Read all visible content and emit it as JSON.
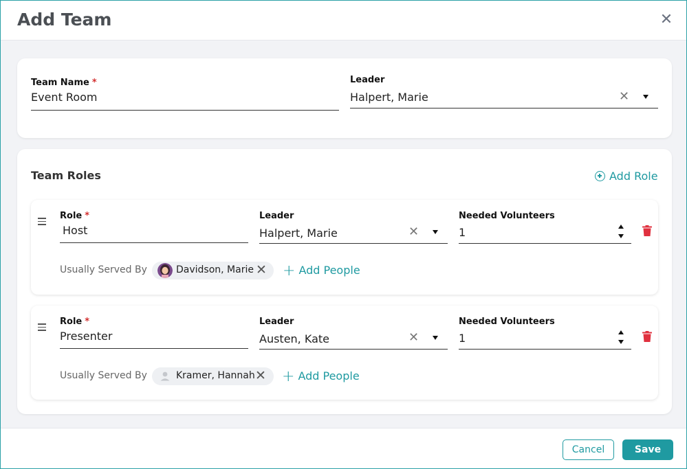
{
  "dialog": {
    "title": "Add Team",
    "close_icon": "close-icon"
  },
  "team": {
    "name_label": "Team Name",
    "name_value": "Event Room",
    "leader_label": "Leader",
    "leader_value": "Halpert, Marie",
    "required_mark": "*"
  },
  "roles_section": {
    "title": "Team Roles",
    "add_role_label": "Add Role"
  },
  "roles": [
    {
      "role_label": "Role",
      "role_value": "Host",
      "leader_label": "Leader",
      "leader_value": "Halpert, Marie",
      "needed_label": "Needed Volunteers",
      "needed_value": "1",
      "served_by_label": "Usually Served By",
      "person": "Davidson, Marie",
      "add_people_label": "Add People"
    },
    {
      "role_label": "Role",
      "role_value": "Presenter",
      "leader_label": "Leader",
      "leader_value": "Austen, Kate",
      "needed_label": "Needed Volunteers",
      "needed_value": "1",
      "served_by_label": "Usually Served By",
      "person": "Kramer, Hannah",
      "add_people_label": "Add People"
    }
  ],
  "footer": {
    "cancel_label": "Cancel",
    "save_label": "Save"
  },
  "colors": {
    "accent": "#1f9aa1",
    "required": "#d32f2f",
    "delete": "#e0313f",
    "background": "#f2f3f6"
  }
}
